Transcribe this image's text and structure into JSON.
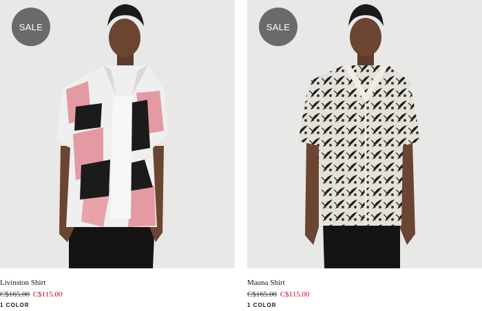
{
  "products": [
    {
      "badge": "SALE",
      "name": "Livinston Shirt",
      "original_price": "C$165.00",
      "sale_price": "C$115.00",
      "colors": "1 COLOR"
    },
    {
      "badge": "SALE",
      "name": "Mauna Shirt",
      "original_price": "C$165.00",
      "sale_price": "C$115.00",
      "colors": "1 COLOR"
    }
  ],
  "colors": {
    "image_background": "#e8e8e6",
    "badge_background": "#6a6a6a",
    "sale_price": "#d0021b"
  }
}
